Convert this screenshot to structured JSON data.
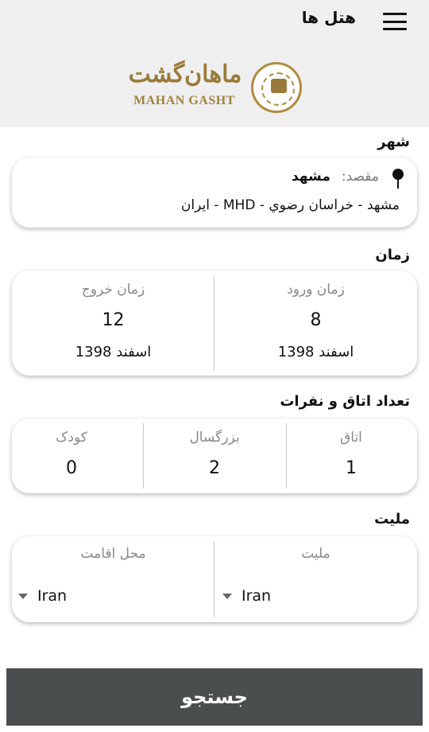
{
  "header": {
    "title": "هتل ها",
    "logo_fa": "ماهان‌گشت",
    "logo_en": "MAHAN GASHT"
  },
  "city": {
    "label": "شهر",
    "dest_label": "مقصد:",
    "dest_value": "مشهد",
    "dest_detail": "مشهد - خراسان رضوي - MHD - ايران"
  },
  "time": {
    "label": "زمان",
    "checkin": {
      "label": "زمان ورود",
      "day": "8",
      "month": "اسفند 1398"
    },
    "checkout": {
      "label": "زمان خروج",
      "day": "12",
      "month": "اسفند 1398"
    }
  },
  "rooms": {
    "label": "تعداد اتاق و نفرات",
    "room": {
      "label": "اتاق",
      "value": "1"
    },
    "adult": {
      "label": "بزرگسال",
      "value": "2"
    },
    "child": {
      "label": "کودک",
      "value": "0"
    }
  },
  "nationality": {
    "label": "مليت",
    "nationality": {
      "label": "مليت",
      "value": "Iran"
    },
    "residence": {
      "label": "محل اقامت",
      "value": "Iran"
    }
  },
  "search_button": "جستجو"
}
